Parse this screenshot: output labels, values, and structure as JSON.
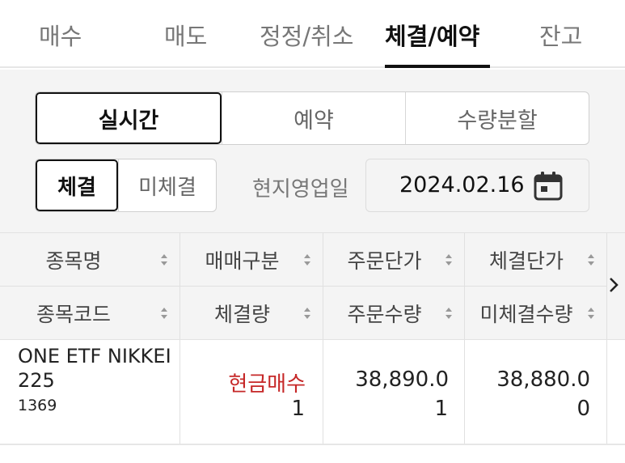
{
  "tabs": [
    "매수",
    "매도",
    "정정/취소",
    "체결/예약",
    "잔고"
  ],
  "active_tab": "체결/예약",
  "mode_segment": {
    "options": [
      "실시간",
      "예약",
      "수량분할"
    ],
    "selected": "실시간"
  },
  "exec_segment": {
    "options": [
      "체결",
      "미체결"
    ],
    "selected": "체결"
  },
  "date": {
    "label": "현지영업일",
    "value": "2024.02.16"
  },
  "table": {
    "header_row1": [
      "종목명",
      "매매구분",
      "주문단가",
      "체결단가"
    ],
    "header_row2": [
      "종목코드",
      "체결량",
      "주문수량",
      "미체결수량"
    ],
    "rows": [
      {
        "name_line1": "ONE ETF NIKKEI",
        "name_line2": "225",
        "code": "1369",
        "trade_type": "현금매수",
        "exec_qty": "1",
        "order_price": "38,890.0",
        "order_qty": "1",
        "exec_price": "38,880.0",
        "unexec_qty": "0"
      }
    ]
  },
  "colors": {
    "active_text": "#111111",
    "inactive_text": "#777777",
    "buy_red": "#c62828",
    "panel_bg": "#f4f4f4"
  },
  "icons": [
    "calendar-icon",
    "sort-icon",
    "chevron-right-icon"
  ]
}
